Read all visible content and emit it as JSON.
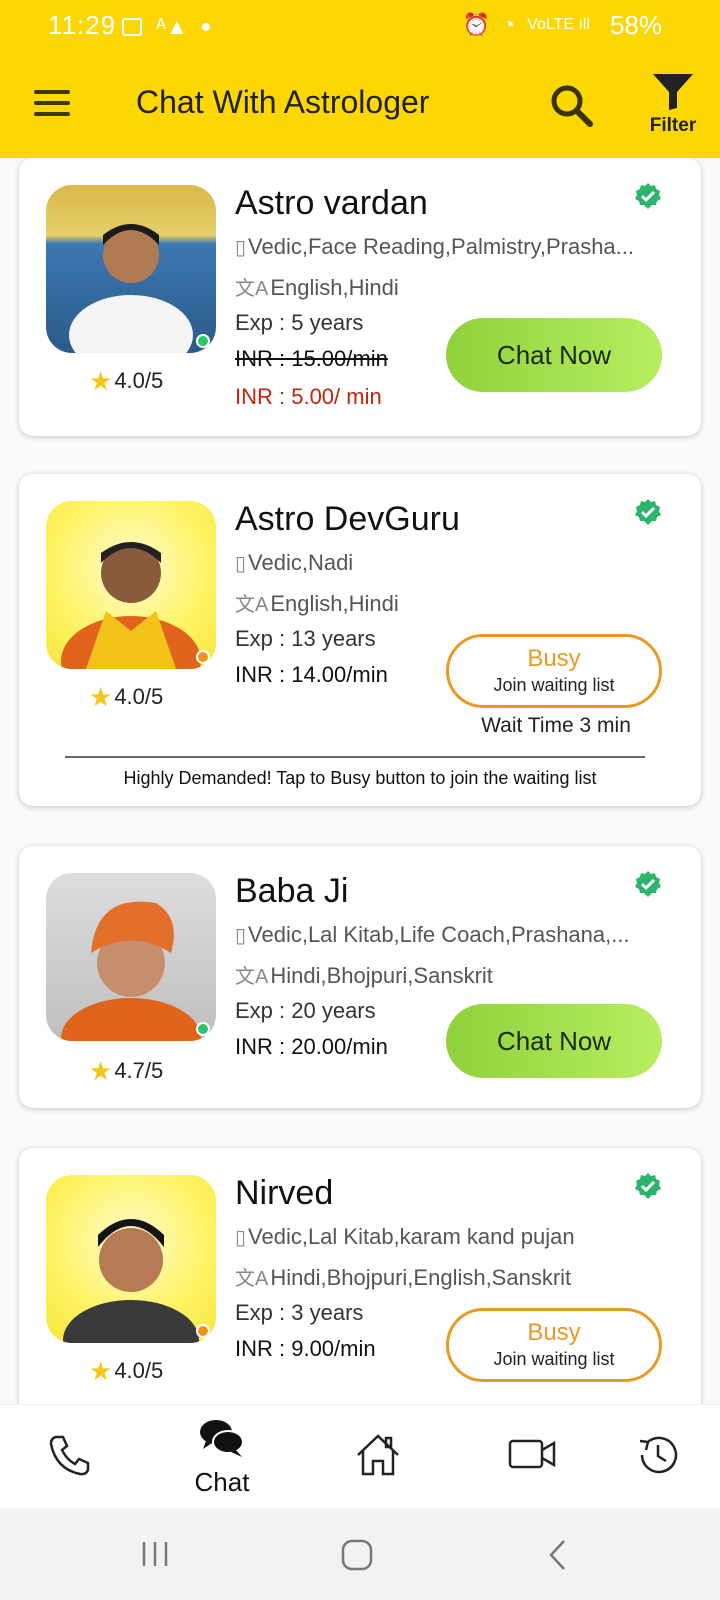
{
  "status_bar": {
    "time": "11:29",
    "battery": "58%"
  },
  "header": {
    "title": "Chat With Astrologer",
    "filter_label": "Filter",
    "bg_color": "#fcd704"
  },
  "astrologers": [
    {
      "name": "Astro vardan",
      "skills": "Vedic,Face Reading,Palmistry,Prasha...",
      "languages": "English,Hindi",
      "experience": "Exp : 5 years",
      "old_price": "INR : 15.00/min",
      "price": "INR : 5.00/ min",
      "rating": "4.0/5",
      "status": "online",
      "action": "Chat Now"
    },
    {
      "name": "Astro DevGuru",
      "skills": "Vedic,Nadi",
      "languages": "English,Hindi",
      "experience": "Exp : 13 years",
      "price": "INR : 14.00/min",
      "rating": "4.0/5",
      "status": "busy",
      "action": "Busy",
      "action_sub": "Join waiting list",
      "wait_time": "Wait Time 3 min",
      "note": "Highly Demanded! Tap to Busy button to join the waiting list"
    },
    {
      "name": "Baba Ji",
      "skills": "Vedic,Lal Kitab,Life Coach,Prashana,...",
      "languages": "Hindi,Bhojpuri,Sanskrit",
      "experience": "Exp : 20 years",
      "price": "INR : 20.00/min",
      "rating": "4.7/5",
      "status": "online",
      "action": "Chat Now"
    },
    {
      "name": "Nirved",
      "skills": "Vedic,Lal Kitab,karam kand pujan",
      "languages": "Hindi,Bhojpuri,English,Sanskrit",
      "experience": "Exp : 3 years",
      "price": "INR : 9.00/min",
      "rating": "4.0/5",
      "status": "busy",
      "action": "Busy",
      "action_sub": "Join waiting list"
    }
  ],
  "bottom_nav": {
    "active_label": "Chat"
  },
  "colors": {
    "chat_button": "#9adc45",
    "busy_border": "#e89a25",
    "discount_price": "#c2240f",
    "verified": "#2bb56a"
  }
}
